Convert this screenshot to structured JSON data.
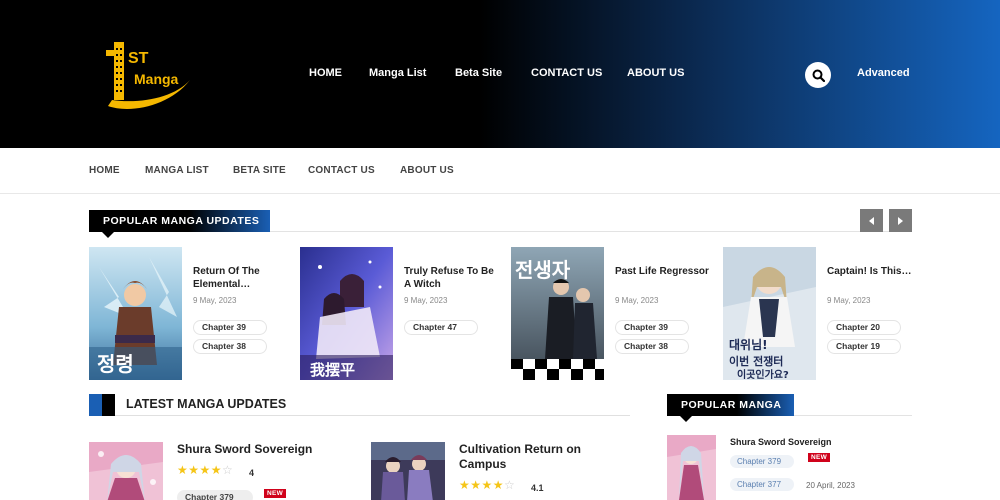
{
  "logo": {
    "mark": "1",
    "superscript": "ST",
    "word": "Manga"
  },
  "header_nav": [
    "HOME",
    "Manga List",
    "Beta Site",
    "CONTACT US",
    "ABOUT US"
  ],
  "advanced_label": "Advanced",
  "secondary_nav": [
    "HOME",
    "MANGA LIST",
    "BETA SITE",
    "CONTACT US",
    "ABOUT US"
  ],
  "popular_updates": {
    "title": "POPULAR MANGA UPDATES",
    "items": [
      {
        "title": "Return Of The Elemental…",
        "date": "9 May, 2023",
        "chapters": [
          "Chapter 39",
          "Chapter 38"
        ]
      },
      {
        "title": "Truly Refuse To Be A Witch",
        "date": "9 May, 2023",
        "chapters": [
          "Chapter 47"
        ]
      },
      {
        "title": "Past Life Regressor",
        "date": "9 May, 2023",
        "chapters": [
          "Chapter 39",
          "Chapter 38"
        ]
      },
      {
        "title": "Captain! Is This…",
        "date": "9 May, 2023",
        "chapters": [
          "Chapter 20",
          "Chapter 19"
        ]
      }
    ]
  },
  "latest": {
    "title": "LATEST MANGA UPDATES",
    "items": [
      {
        "title": "Shura Sword Sovereign",
        "rating": "4",
        "stars": 4,
        "chapter": "Chapter 379",
        "badge": "NEW"
      },
      {
        "title": "Cultivation Return on Campus",
        "rating": "4.1",
        "stars": 4,
        "chapter": "",
        "badge": ""
      }
    ]
  },
  "sidebar_popular": {
    "title": "POPULAR MANGA",
    "items": [
      {
        "title": "Shura Sword Sovereign",
        "chapters": [
          "Chapter 379",
          "Chapter 377"
        ],
        "badge": "NEW",
        "date": "20 April, 2023"
      }
    ]
  },
  "colors": {
    "accent_blue": "#1565c0",
    "new_badge": "#d0021b",
    "star": "#f5c518"
  },
  "icons": [
    "search-icon",
    "arrow-left-icon",
    "arrow-right-icon"
  ]
}
